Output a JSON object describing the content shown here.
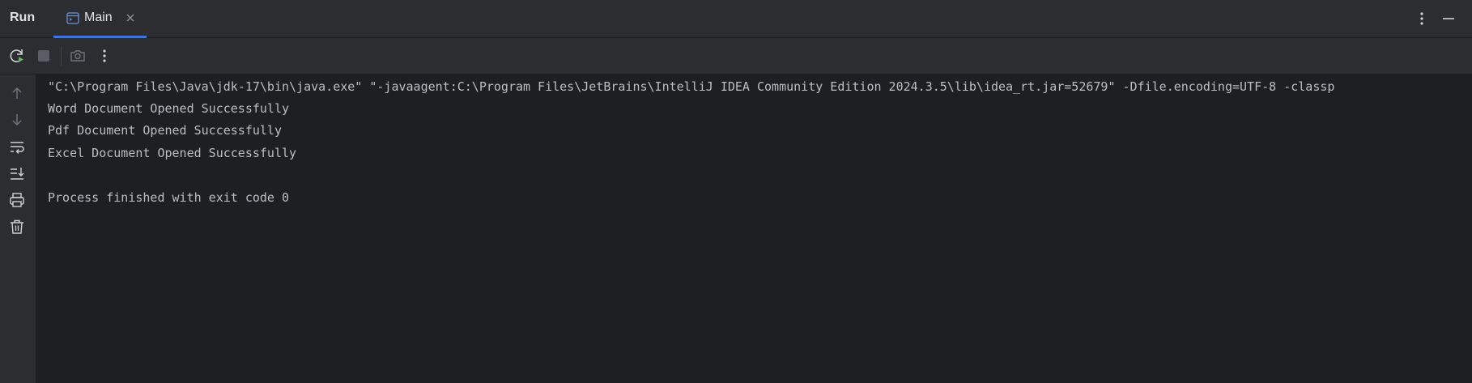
{
  "header": {
    "title": "Run",
    "tab": {
      "label": "Main",
      "icon": "console-window-icon",
      "close_icon": "close-icon"
    },
    "more_icon": "kebab-menu-icon",
    "minimize_icon": "minimize-icon"
  },
  "toolbar": {
    "icons": [
      "rerun-icon",
      "stop-icon",
      "camera-icon",
      "kebab-menu-icon"
    ]
  },
  "sidebar": {
    "icons": [
      "arrow-up-icon",
      "arrow-down-icon",
      "soft-wrap-icon",
      "scroll-to-end-icon",
      "print-icon",
      "trash-icon"
    ]
  },
  "console": {
    "lines": [
      "\"C:\\Program Files\\Java\\jdk-17\\bin\\java.exe\" \"-javaagent:C:\\Program Files\\JetBrains\\IntelliJ IDEA Community Edition 2024.3.5\\lib\\idea_rt.jar=52679\" -Dfile.encoding=UTF-8 -classp",
      "Word Document Opened Successfully",
      "Pdf Document Opened Successfully",
      "Excel Document Opened Successfully",
      "",
      "Process finished with exit code 0"
    ]
  },
  "colors": {
    "background": "#1e1f22",
    "panel": "#2b2d30",
    "text": "#bcbec4",
    "accent": "#3574f0",
    "run_green": "#5fb865"
  }
}
